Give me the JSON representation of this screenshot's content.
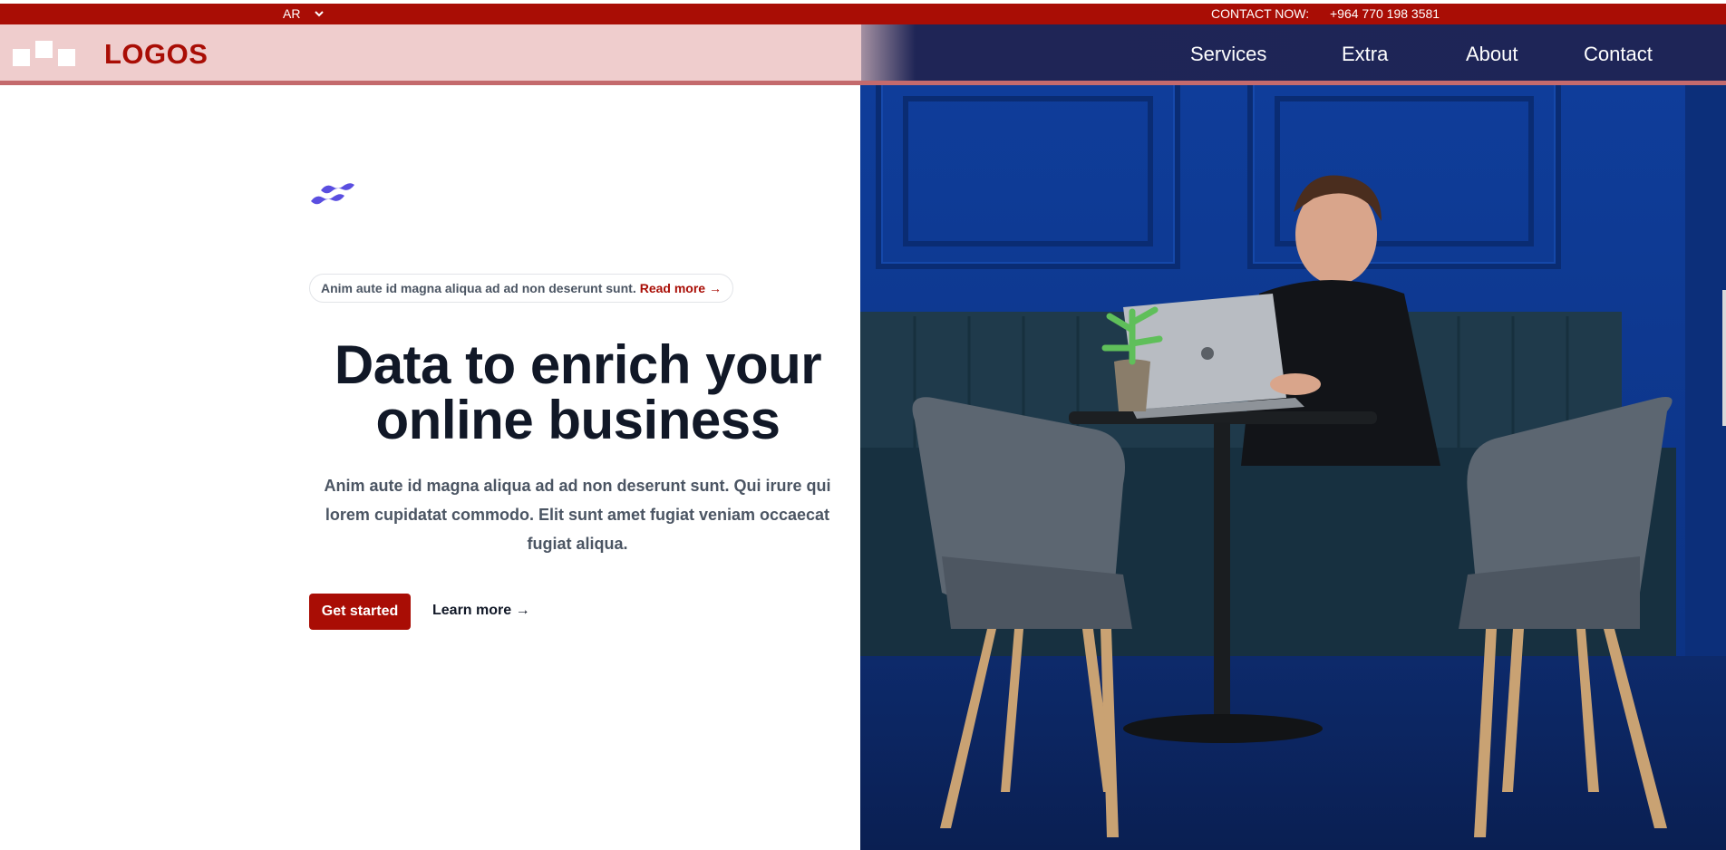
{
  "topbar": {
    "language": "AR",
    "contact_label": "CONTACT NOW:",
    "contact_phone": "+964 770 198 3581"
  },
  "header": {
    "logo_text": "LOGOS",
    "nav": [
      "Services",
      "Extra",
      "About",
      "Contact"
    ]
  },
  "hero": {
    "announcement_text": "Anim aute id magna aliqua ad ad non deserunt sunt.",
    "announcement_link": "Read more →",
    "headline_line1": "Data to enrich your",
    "headline_line2": "online business",
    "subtext": "Anim aute id magna aliqua ad ad non deserunt sunt. Qui irure qui lorem cupidatat commodo. Elit sunt amet fugiat veniam occaecat fugiat aliqua.",
    "primary_button": "Get started",
    "secondary_link": "Learn more →"
  },
  "colors": {
    "brand_red": "#a90d05",
    "header_pink": "#efcdcd",
    "header_navy": "#1f2556",
    "heading": "#111827",
    "body_text": "#4b5563",
    "tailwind_indigo": "#5a4ee0"
  },
  "icons": {
    "language_caret": "chevron-down-icon",
    "brand_mark": "tailwind-wave-icon"
  }
}
